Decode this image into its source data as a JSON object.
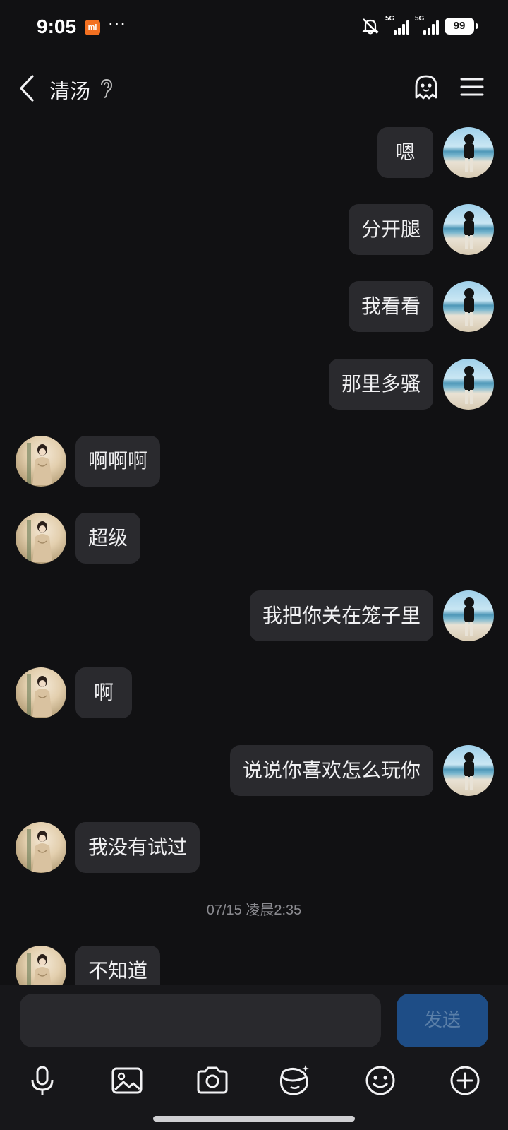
{
  "status_bar": {
    "time": "9:05",
    "mi_badge": "mi",
    "dots": "···",
    "network_1": "5G",
    "network_2": "5G",
    "battery": "99"
  },
  "header": {
    "title": "清汤"
  },
  "messages": [
    {
      "from": "me",
      "text": "嗯"
    },
    {
      "from": "me",
      "text": "分开腿"
    },
    {
      "from": "me",
      "text": "我看看"
    },
    {
      "from": "me",
      "text": "那里多骚"
    },
    {
      "from": "other",
      "text": "啊啊啊"
    },
    {
      "from": "other",
      "text": "超级"
    },
    {
      "from": "me",
      "text": "我把你关在笼子里"
    },
    {
      "from": "other",
      "text": "啊"
    },
    {
      "from": "me",
      "text": "说说你喜欢怎么玩你"
    },
    {
      "from": "other",
      "text": "我没有试过"
    },
    {
      "from": "other",
      "text": "不知道"
    }
  ],
  "time_separator": "07/15 凌晨2:35",
  "composer": {
    "value": "",
    "send_label": "发送"
  },
  "toolbar": [
    "microphone-icon",
    "image-icon",
    "camera-icon",
    "sticker-icon",
    "emoji-icon",
    "plus-icon"
  ],
  "colors": {
    "background": "#111113",
    "bubble": "#2a2a2e",
    "send_button": "#1e4d86"
  }
}
